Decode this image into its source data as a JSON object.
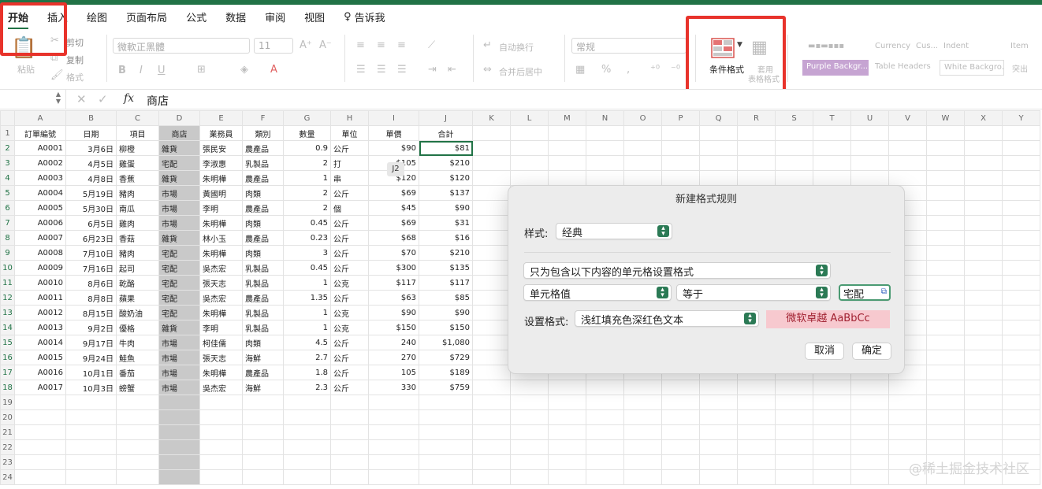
{
  "tabs": [
    "开始",
    "插入",
    "绘图",
    "页面布局",
    "公式",
    "数据",
    "审阅",
    "视图"
  ],
  "tell_me": "告诉我",
  "ribbon": {
    "cut": "剪切",
    "copy": "复制",
    "format_painter": "格式",
    "paste": "粘贴",
    "font": "微軟正黑體",
    "size": "11",
    "wrap": "自动换行",
    "merge": "合并后居中",
    "number_format": "常规",
    "cond_format": "条件格式",
    "table_format_1": "套用",
    "table_format_2": "表格格式",
    "styles": [
      "Currency",
      "Cus...",
      "Indent",
      "Item",
      "Purple Backgr...",
      "Table Headers",
      "White Backgro...",
      "突出"
    ]
  },
  "formula_bar": {
    "fx": "fx",
    "value": "商店"
  },
  "columns": [
    "A",
    "B",
    "C",
    "D",
    "E",
    "F",
    "G",
    "H",
    "I",
    "J",
    "K",
    "L",
    "M",
    "N",
    "O",
    "P",
    "Q",
    "R",
    "S",
    "T",
    "U",
    "V",
    "W",
    "X",
    "Y"
  ],
  "headers": [
    "訂單編號",
    "日期",
    "項目",
    "商店",
    "業務員",
    "類別",
    "數量",
    "單位",
    "單價",
    "合計"
  ],
  "rows": [
    [
      "A0001",
      "3月6日",
      "柳橙",
      "雜貨",
      "張民安",
      "農產品",
      "0.9",
      "公斤",
      "$90",
      "$81"
    ],
    [
      "A0002",
      "4月5日",
      "雞蛋",
      "宅配",
      "李淑惠",
      "乳製品",
      "2",
      "打",
      "$105",
      "$210"
    ],
    [
      "A0003",
      "4月8日",
      "香蕉",
      "雜貨",
      "朱明樺",
      "農產品",
      "1",
      "串",
      "$120",
      "$120"
    ],
    [
      "A0004",
      "5月19日",
      "豬肉",
      "市場",
      "黃國明",
      "肉類",
      "2",
      "公斤",
      "$69",
      "$137"
    ],
    [
      "A0005",
      "5月30日",
      "南瓜",
      "市場",
      "李明",
      "農產品",
      "2",
      "個",
      "$45",
      "$90"
    ],
    [
      "A0006",
      "6月5日",
      "雞肉",
      "市場",
      "朱明樺",
      "肉類",
      "0.45",
      "公斤",
      "$69",
      "$31"
    ],
    [
      "A0007",
      "6月23日",
      "香菇",
      "雜貨",
      "林小玉",
      "農產品",
      "0.23",
      "公斤",
      "$68",
      "$16"
    ],
    [
      "A0008",
      "7月10日",
      "豬肉",
      "宅配",
      "朱明樺",
      "肉類",
      "3",
      "公斤",
      "$70",
      "$210"
    ],
    [
      "A0009",
      "7月16日",
      "起司",
      "宅配",
      "吳杰宏",
      "乳製品",
      "0.45",
      "公斤",
      "$300",
      "$135"
    ],
    [
      "A0010",
      "8月6日",
      "乾酪",
      "宅配",
      "張天志",
      "乳製品",
      "1",
      "公克",
      "$117",
      "$117"
    ],
    [
      "A0011",
      "8月8日",
      "蘋果",
      "宅配",
      "吳杰宏",
      "農產品",
      "1.35",
      "公斤",
      "$63",
      "$85"
    ],
    [
      "A0012",
      "8月15日",
      "酸奶油",
      "宅配",
      "朱明樺",
      "乳製品",
      "1",
      "公克",
      "$90",
      "$90"
    ],
    [
      "A0013",
      "9月2日",
      "優格",
      "雜貨",
      "李明",
      "乳製品",
      "1",
      "公克",
      "$150",
      "$150"
    ],
    [
      "A0014",
      "9月17日",
      "牛肉",
      "市場",
      "柯佳儒",
      "肉類",
      "4.5",
      "公斤",
      "240",
      "$1,080"
    ],
    [
      "A0015",
      "9月24日",
      "鮭魚",
      "市場",
      "張天志",
      "海鮮",
      "2.7",
      "公斤",
      "270",
      "$729"
    ],
    [
      "A0016",
      "10月1日",
      "番茄",
      "市場",
      "朱明樺",
      "農產品",
      "1.8",
      "公斤",
      "105",
      "$189"
    ],
    [
      "A0017",
      "10月3日",
      "螃蟹",
      "市場",
      "吳杰宏",
      "海鮮",
      "2.3",
      "公斤",
      "330",
      "$759"
    ]
  ],
  "row_numbers": [
    "1",
    "2",
    "3",
    "4",
    "5",
    "6",
    "7",
    "8",
    "9",
    "10",
    "11",
    "12",
    "13",
    "14",
    "15",
    "16",
    "17",
    "18",
    "19",
    "20",
    "21",
    "22",
    "23",
    "24"
  ],
  "cell_tooltip": "J2",
  "dialog": {
    "title": "新建格式规则",
    "style_label": "样式:",
    "style_value": "经典",
    "rule_type": "只为包含以下内容的单元格设置格式",
    "cond1": "单元格值",
    "cond2": "等于",
    "cond_value": "宅配",
    "format_label": "设置格式:",
    "format_value": "浅红填充色深红色文本",
    "preview": "微软卓越  AaBbCc",
    "cancel": "取消",
    "ok": "确定"
  },
  "watermark": "@稀土掘金技术社区"
}
